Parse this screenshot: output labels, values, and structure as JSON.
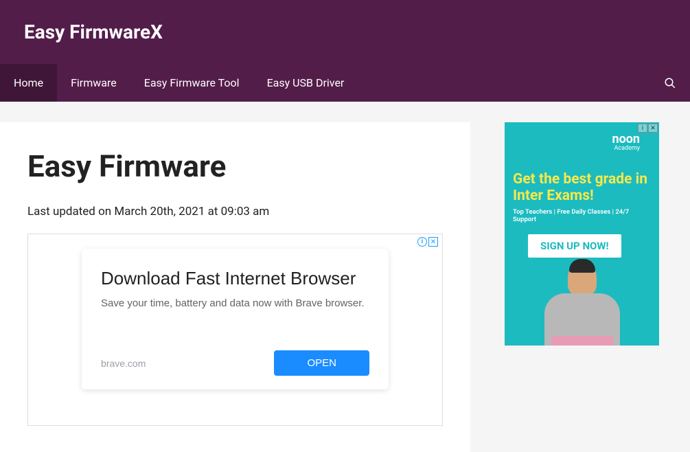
{
  "header": {
    "site_title": "Easy FirmwareX"
  },
  "nav": {
    "items": [
      {
        "label": "Home",
        "active": true
      },
      {
        "label": "Firmware",
        "active": false
      },
      {
        "label": "Easy Firmware Tool",
        "active": false
      },
      {
        "label": "Easy USB Driver",
        "active": false
      }
    ]
  },
  "page": {
    "title": "Easy Firmware",
    "last_updated": "Last updated on March 20th, 2021 at 09:03 am"
  },
  "main_ad": {
    "title": "Download Fast Internet Browser",
    "description": "Save your time, battery and data now with Brave browser.",
    "domain": "brave.com",
    "cta": "OPEN"
  },
  "side_ad": {
    "brand": "noon",
    "brand_sub": "Academy",
    "headline": "Get the best grade in Inter Exams!",
    "subtext": "Top Teachers | Free Daily Classes | 24/7 Support",
    "cta": "SIGN UP NOW!"
  }
}
